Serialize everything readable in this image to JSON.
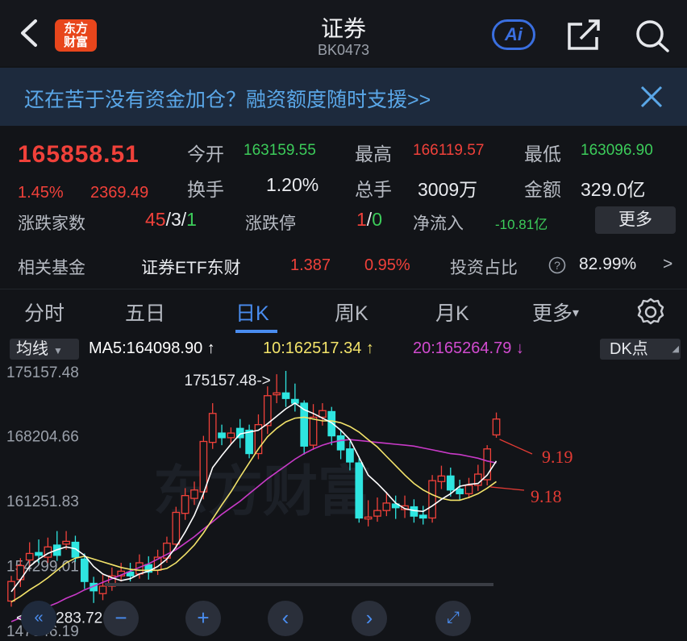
{
  "header": {
    "title": "证券",
    "code": "BK0473",
    "logo_lines": [
      "东方",
      "财富"
    ],
    "ai_label": "Ai",
    "icons": [
      "back-arrow-icon",
      "share-icon",
      "search-icon"
    ]
  },
  "banner": {
    "text": "还在苦于没有资金加仓？融资额度随时支援>>"
  },
  "quote": {
    "price": "165858.51",
    "change_pct": "1.45%",
    "change_abs": "2369.49",
    "open_label": "今开",
    "open_value": "163159.55",
    "high_label": "最高",
    "high_value": "166119.57",
    "low_label": "最低",
    "low_value": "163096.90",
    "turnover_label": "换手",
    "turnover_value": "1.20%",
    "volume_label": "总手",
    "volume_value": "3009万",
    "amount_label": "金额",
    "amount_value": "329.0亿",
    "breadth_label": "涨跌家数",
    "breadth_up": "45",
    "breadth_sep1": "/",
    "breadth_flat": "3",
    "breadth_sep2": "/",
    "breadth_down": "1",
    "limit_label": "涨跌停",
    "limit_up": "1",
    "limit_sep": "/",
    "limit_down": "0",
    "netflow_label": "净流入",
    "netflow_value": "-10.81亿",
    "more_label": "更多"
  },
  "fund": {
    "label": "相关基金",
    "name": "证券ETF东财",
    "price": "1.387",
    "pct": "0.95%",
    "ratio_label": "投资占比",
    "ratio_value": "82.99%",
    "arrow": ">"
  },
  "tabs": {
    "items": [
      "分时",
      "五日",
      "日K",
      "周K",
      "月K",
      "更多"
    ],
    "active": "日K",
    "more_caret": "▾"
  },
  "chart_controls": {
    "ma_select": "均线",
    "ma5": "MA5:164098.90 ↑",
    "ma10": "10:162517.34 ↑",
    "ma20": "20:165264.79 ↓",
    "dk_label": "DK点"
  },
  "chart_data": {
    "type": "candlestick",
    "y_ticks": [
      "175157.48",
      "168204.66",
      "161251.83",
      "154299.01",
      "147346.19"
    ],
    "ylim": [
      147346.19,
      175157.48
    ],
    "max_annotation": "175157.48->",
    "min_annotation": "<-151283.72",
    "dk_annotations": [
      "9.19",
      "9.18"
    ],
    "watermark": "东方财富",
    "candles": [
      {
        "o": 150500,
        "c": 152600,
        "h": 153200,
        "l": 149900
      },
      {
        "o": 152800,
        "c": 154300,
        "h": 155100,
        "l": 152000
      },
      {
        "o": 154900,
        "c": 155600,
        "h": 156800,
        "l": 154200
      },
      {
        "o": 155700,
        "c": 155400,
        "h": 157100,
        "l": 154600
      },
      {
        "o": 155200,
        "c": 156300,
        "h": 157300,
        "l": 154600
      },
      {
        "o": 156500,
        "c": 155400,
        "h": 158000,
        "l": 154800
      },
      {
        "o": 156600,
        "c": 156900,
        "h": 158000,
        "l": 156000
      },
      {
        "o": 156800,
        "c": 155200,
        "h": 157500,
        "l": 154700
      },
      {
        "o": 155000,
        "c": 152600,
        "h": 155600,
        "l": 151800
      },
      {
        "o": 152400,
        "c": 151600,
        "h": 153100,
        "l": 150300
      },
      {
        "o": 151300,
        "c": 152100,
        "h": 153300,
        "l": 150600
      },
      {
        "o": 152100,
        "c": 153200,
        "h": 154100,
        "l": 151600
      },
      {
        "o": 153200,
        "c": 153700,
        "h": 154600,
        "l": 152600
      },
      {
        "o": 153600,
        "c": 153200,
        "h": 154600,
        "l": 152600
      },
      {
        "o": 153400,
        "c": 154600,
        "h": 155500,
        "l": 152900
      },
      {
        "o": 154400,
        "c": 153600,
        "h": 155300,
        "l": 152800
      },
      {
        "o": 153800,
        "c": 155200,
        "h": 156000,
        "l": 153300
      },
      {
        "o": 155100,
        "c": 156700,
        "h": 157400,
        "l": 154600
      },
      {
        "o": 156600,
        "c": 160000,
        "h": 160600,
        "l": 156100
      },
      {
        "o": 159900,
        "c": 161800,
        "h": 162600,
        "l": 159200
      },
      {
        "o": 161500,
        "c": 162400,
        "h": 163300,
        "l": 160800
      },
      {
        "o": 162200,
        "c": 167600,
        "h": 168200,
        "l": 161400
      },
      {
        "o": 167500,
        "c": 170600,
        "h": 171700,
        "l": 166800
      },
      {
        "o": 168500,
        "c": 168000,
        "h": 169400,
        "l": 167200
      },
      {
        "o": 168000,
        "c": 168500,
        "h": 169100,
        "l": 167300
      },
      {
        "o": 169000,
        "c": 168000,
        "h": 170000,
        "l": 166900
      },
      {
        "o": 168800,
        "c": 166300,
        "h": 169400,
        "l": 165800
      },
      {
        "o": 166300,
        "c": 169400,
        "h": 170500,
        "l": 165700
      },
      {
        "o": 169300,
        "c": 172500,
        "h": 173500,
        "l": 168400
      },
      {
        "o": 172600,
        "c": 172800,
        "h": 174800,
        "l": 171700
      },
      {
        "o": 172800,
        "c": 172200,
        "h": 175157,
        "l": 171300
      },
      {
        "o": 172100,
        "c": 171700,
        "h": 173800,
        "l": 170800
      },
      {
        "o": 171700,
        "c": 167100,
        "h": 172000,
        "l": 166200
      },
      {
        "o": 167200,
        "c": 170200,
        "h": 171600,
        "l": 166700
      },
      {
        "o": 170200,
        "c": 170900,
        "h": 171700,
        "l": 169300
      },
      {
        "o": 170800,
        "c": 168200,
        "h": 171300,
        "l": 167200
      },
      {
        "o": 168200,
        "c": 166700,
        "h": 168900,
        "l": 165700
      },
      {
        "o": 166800,
        "c": 165400,
        "h": 167600,
        "l": 164500
      },
      {
        "o": 165300,
        "c": 159400,
        "h": 166000,
        "l": 158900
      },
      {
        "o": 159300,
        "c": 159500,
        "h": 161300,
        "l": 158500
      },
      {
        "o": 159600,
        "c": 160200,
        "h": 161600,
        "l": 159000
      },
      {
        "o": 160200,
        "c": 161000,
        "h": 162200,
        "l": 159600
      },
      {
        "o": 160900,
        "c": 160500,
        "h": 161800,
        "l": 159300
      },
      {
        "o": 160300,
        "c": 160700,
        "h": 161800,
        "l": 159400
      },
      {
        "o": 160600,
        "c": 159600,
        "h": 161400,
        "l": 158900
      },
      {
        "o": 159700,
        "c": 159400,
        "h": 160700,
        "l": 158700
      },
      {
        "o": 159400,
        "c": 163400,
        "h": 164000,
        "l": 158900
      },
      {
        "o": 163300,
        "c": 163900,
        "h": 165000,
        "l": 162500
      },
      {
        "o": 163900,
        "c": 162400,
        "h": 164800,
        "l": 161700
      },
      {
        "o": 162500,
        "c": 162000,
        "h": 163500,
        "l": 161300
      },
      {
        "o": 162000,
        "c": 162900,
        "h": 163700,
        "l": 161500
      },
      {
        "o": 162900,
        "c": 164100,
        "h": 165100,
        "l": 162300
      },
      {
        "o": 163500,
        "c": 166800,
        "h": 167200,
        "l": 162900
      },
      {
        "o": 168300,
        "c": 170000,
        "h": 170700,
        "l": 168000
      }
    ],
    "ma5": [
      151500,
      152800,
      154200,
      155000,
      155600,
      156000,
      156300,
      156100,
      155400,
      154200,
      153400,
      153000,
      152700,
      152900,
      153400,
      153700,
      154200,
      155000,
      156300,
      157900,
      159700,
      162000,
      164800,
      166100,
      167300,
      168400,
      168600,
      168800,
      169500,
      170300,
      171100,
      171700,
      171000,
      170600,
      170100,
      169600,
      168800,
      167800,
      165900,
      164000,
      163100,
      162100,
      161000,
      160400,
      160200,
      160100,
      160700,
      161400,
      162000,
      162800,
      163000,
      163100,
      164000,
      165500
    ],
    "ma10": [
      150400,
      151000,
      151700,
      152300,
      153000,
      153800,
      154600,
      155100,
      155300,
      155000,
      154700,
      154400,
      154100,
      153900,
      153800,
      153800,
      153800,
      154000,
      154600,
      155500,
      156500,
      157800,
      159300,
      160800,
      162200,
      163800,
      165300,
      166800,
      168100,
      169000,
      169700,
      170100,
      170200,
      170000,
      169800,
      169800,
      169600,
      169200,
      168600,
      167800,
      167000,
      166000,
      165000,
      164000,
      163100,
      162400,
      161900,
      161500,
      161300,
      161300,
      161600,
      162000,
      162600,
      163300
    ],
    "ma20": [
      148300,
      148700,
      149100,
      149500,
      149900,
      150300,
      150800,
      151200,
      151700,
      152100,
      152500,
      152900,
      153300,
      153700,
      154100,
      154500,
      155000,
      155500,
      156000,
      156700,
      157400,
      158200,
      159000,
      159800,
      160500,
      161200,
      162000,
      162800,
      163600,
      164300,
      165000,
      165700,
      166300,
      166800,
      167200,
      167500,
      167700,
      167800,
      167700,
      167600,
      167500,
      167400,
      167300,
      167200,
      167100,
      166900,
      166700,
      166500,
      166300,
      166200,
      166000,
      165800,
      165500,
      165300
    ]
  },
  "bottom_controls": [
    "collapse-left",
    "zoom-out",
    "zoom-in",
    "scroll-left",
    "scroll-right",
    "fullscreen"
  ],
  "colors": {
    "up": "#f0413a",
    "down": "#2ee5e0",
    "ma5": "#ffffff",
    "ma10": "#f3e36a",
    "ma20": "#c93ac8",
    "accent": "#4a8df0",
    "background": "#121418"
  }
}
